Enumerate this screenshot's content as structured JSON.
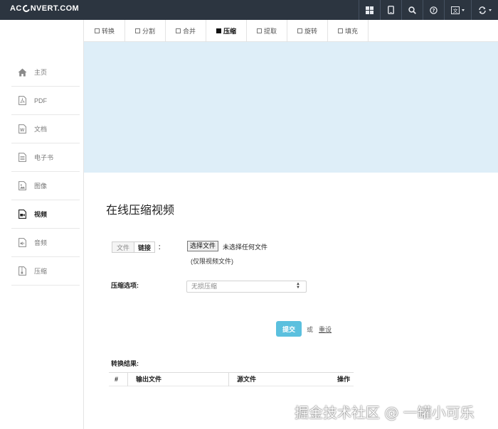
{
  "brand": {
    "logo_text_left": "AC",
    "logo_text_right": "NVERT.COM"
  },
  "topnav": {
    "icons": [
      "grid-icon",
      "tablet-icon",
      "search-icon",
      "help-icon",
      "language-icon",
      "refresh-icon"
    ]
  },
  "sidebar": {
    "items": [
      {
        "label": "主页",
        "icon": "home-icon",
        "active": false
      },
      {
        "label": "PDF",
        "icon": "pdf-file-icon",
        "active": false
      },
      {
        "label": "文档",
        "icon": "word-file-icon",
        "active": false
      },
      {
        "label": "电子书",
        "icon": "ebook-file-icon",
        "active": false
      },
      {
        "label": "图像",
        "icon": "image-file-icon",
        "active": false
      },
      {
        "label": "视频",
        "icon": "video-file-icon",
        "active": true
      },
      {
        "label": "音频",
        "icon": "audio-file-icon",
        "active": false
      },
      {
        "label": "压缩",
        "icon": "archive-file-icon",
        "active": false
      }
    ]
  },
  "tabs": [
    {
      "label": "转换",
      "active": false
    },
    {
      "label": "分割",
      "active": false
    },
    {
      "label": "合并",
      "active": false
    },
    {
      "label": "压缩",
      "active": true
    },
    {
      "label": "提取",
      "active": false
    },
    {
      "label": "旋转",
      "active": false
    },
    {
      "label": "填充",
      "active": false
    }
  ],
  "main": {
    "title": "在线压缩视频",
    "source_toggle": {
      "file_label": "文件",
      "link_label": "链接",
      "colon": "："
    },
    "file_input": {
      "button_label": "选择文件",
      "status": "未选择任何文件",
      "hint": "(仅限视频文件)"
    },
    "compress_option": {
      "label": "压缩选项:",
      "selected": "无损压缩"
    },
    "submit_label": "提交",
    "or_text": "或",
    "reset_label": "重设",
    "results": {
      "label": "转换结果:",
      "headers": [
        "#",
        "输出文件",
        "源文件",
        "操作"
      ]
    }
  },
  "watermark": "掘金技术社区 @ 一罐小可乐",
  "colors": {
    "topbar": "#2c3540",
    "banner": "#deeef8",
    "submit": "#5bc0de"
  }
}
